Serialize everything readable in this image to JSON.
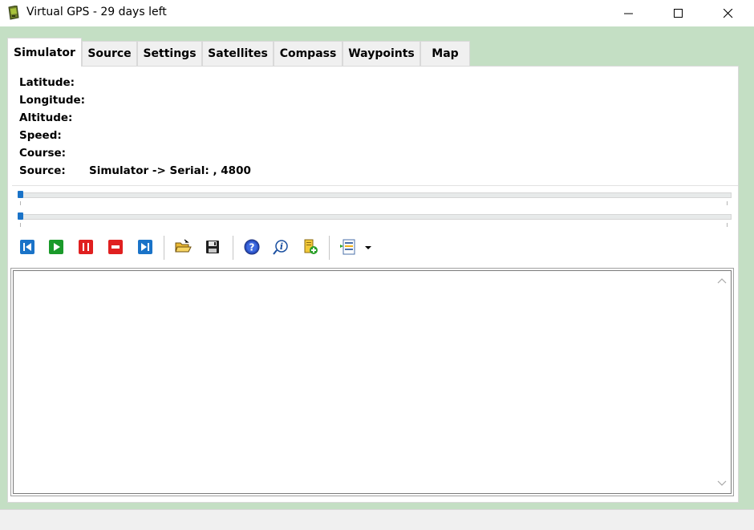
{
  "window": {
    "title": "Virtual GPS - 29 days left",
    "minimize_label": "Minimize",
    "maximize_label": "Maximize",
    "close_label": "Close"
  },
  "tabs": [
    {
      "label": "Simulator",
      "active": true
    },
    {
      "label": "Source",
      "active": false
    },
    {
      "label": "Settings",
      "active": false
    },
    {
      "label": "Satellites",
      "active": false
    },
    {
      "label": "Compass",
      "active": false
    },
    {
      "label": "Waypoints",
      "active": false
    },
    {
      "label": "Map",
      "active": false
    }
  ],
  "info": {
    "latitude": {
      "label": "Latitude:",
      "value": ""
    },
    "longitude": {
      "label": "Longitude:",
      "value": ""
    },
    "altitude": {
      "label": "Altitude:",
      "value": ""
    },
    "speed": {
      "label": "Speed:",
      "value": ""
    },
    "course": {
      "label": "Course:",
      "value": ""
    },
    "source": {
      "label": "Source:",
      "value": "Simulator -> Serial: , 4800"
    }
  },
  "sliders": {
    "position": 0,
    "speed": 0
  },
  "toolbar": {
    "buttons": [
      {
        "name": "skip-to-start",
        "icon": "skip-back-icon"
      },
      {
        "name": "play",
        "icon": "play-icon"
      },
      {
        "name": "pause",
        "icon": "pause-icon"
      },
      {
        "name": "stop",
        "icon": "stop-icon"
      },
      {
        "name": "skip-to-end",
        "icon": "skip-forward-icon"
      },
      {
        "name": "open",
        "icon": "folder-open-icon"
      },
      {
        "name": "save",
        "icon": "floppy-disk-icon"
      },
      {
        "name": "help",
        "icon": "help-icon"
      },
      {
        "name": "about",
        "icon": "info-icon"
      },
      {
        "name": "add-document",
        "icon": "document-add-icon"
      },
      {
        "name": "log-options",
        "icon": "log-list-icon"
      }
    ]
  },
  "log": {
    "text": ""
  },
  "colors": {
    "client_bg": "#c4dfc4",
    "accent_blue": "#1a73c8",
    "play_green": "#1a9a2a",
    "stop_red": "#e02020"
  }
}
